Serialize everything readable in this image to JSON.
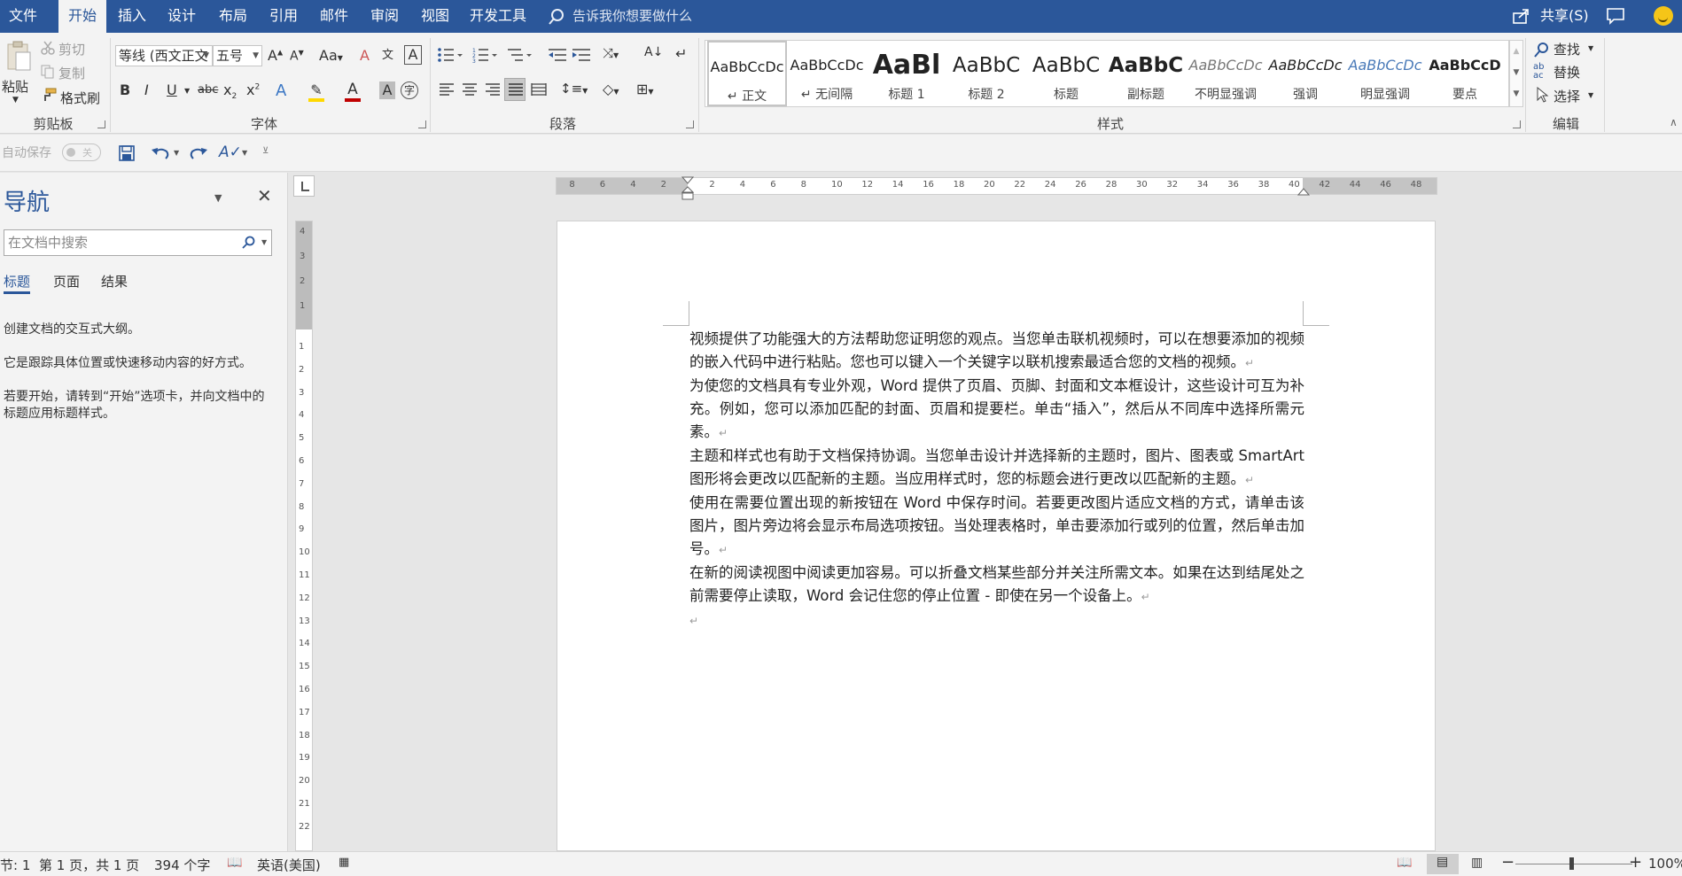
{
  "menubar": {
    "tabs": [
      "文件",
      "开始",
      "插入",
      "设计",
      "布局",
      "引用",
      "邮件",
      "审阅",
      "视图",
      "开发工具"
    ],
    "active_tab": "开始",
    "tell_me": "告诉我你想要做什么",
    "share": "共享(S)"
  },
  "ribbon": {
    "clipboard": {
      "paste": "粘贴",
      "cut": "剪切",
      "copy": "复制",
      "format_painter": "格式刷",
      "label": "剪贴板"
    },
    "font": {
      "font_name": "等线 (西文正文",
      "font_size": "五号",
      "change_case": "Aa",
      "label": "字体"
    },
    "paragraph": {
      "label": "段落"
    },
    "styles": {
      "label": "样式",
      "items": [
        {
          "sample": "AaBbCcDc",
          "name": "正文"
        },
        {
          "sample": "AaBbCcDc",
          "name": "无间隔"
        },
        {
          "sample": "AaBl",
          "name": "标题 1"
        },
        {
          "sample": "AaBbC",
          "name": "标题 2"
        },
        {
          "sample": "AaBbC",
          "name": "标题"
        },
        {
          "sample": "AaBbC",
          "name": "副标题"
        },
        {
          "sample": "AaBbCcDc",
          "name": "不明显强调"
        },
        {
          "sample": "AaBbCcDc",
          "name": "强调"
        },
        {
          "sample": "AaBbCcDc",
          "name": "明显强调"
        },
        {
          "sample": "AaBbCcD",
          "name": "要点"
        }
      ]
    },
    "editing": {
      "find": "查找",
      "replace": "替换",
      "select": "选择",
      "label": "编辑"
    }
  },
  "qat": {
    "autosave": "自动保存",
    "autosave_state": "关"
  },
  "nav": {
    "title": "导航",
    "search_placeholder": "在文档中搜索",
    "tabs": [
      "标题",
      "页面",
      "结果"
    ],
    "text1": "创建文档的交互式大纲。",
    "text2": "它是跟踪具体位置或快速移动内容的好方式。",
    "text3": "若要开始，请转到“开始”选项卡，并向文档中的标题应用标题样式。"
  },
  "ruler": {
    "h_left": [
      "8",
      "6",
      "4",
      "2"
    ],
    "h_right": [
      "2",
      "4",
      "6",
      "8",
      "10",
      "12",
      "14",
      "16",
      "18",
      "20",
      "22",
      "24",
      "26",
      "28",
      "30",
      "32",
      "34",
      "36",
      "38",
      "40",
      "42",
      "44",
      "46",
      "48"
    ],
    "v_top": [
      "4",
      "3",
      "2",
      "1"
    ],
    "v_nums": [
      "1",
      "2",
      "3",
      "4",
      "5",
      "6",
      "7",
      "8",
      "9",
      "10",
      "11",
      "12",
      "13",
      "14",
      "15",
      "16",
      "17",
      "18",
      "19",
      "20",
      "21",
      "22"
    ]
  },
  "document": {
    "paragraphs": [
      "视频提供了功能强大的方法帮助您证明您的观点。当您单击联机视频时，可以在想要添加的视频的嵌入代码中进行粘贴。您也可以键入一个关键字以联机搜索最适合您的文档的视频。",
      "为使您的文档具有专业外观，Word 提供了页眉、页脚、封面和文本框设计，这些设计可互为补充。例如，您可以添加匹配的封面、页眉和提要栏。单击“插入”，然后从不同库中选择所需元素。",
      "主题和样式也有助于文档保持协调。当您单击设计并选择新的主题时，图片、图表或 SmartArt 图形将会更改以匹配新的主题。当应用样式时，您的标题会进行更改以匹配新的主题。",
      "使用在需要位置出现的新按钮在 Word 中保存时间。若要更改图片适应文档的方式，请单击该图片，图片旁边将会显示布局选项按钮。当处理表格时，单击要添加行或列的位置，然后单击加号。",
      "在新的阅读视图中阅读更加容易。可以折叠文档某些部分并关注所需文本。如果在达到结尾处之前需要停止读取，Word 会记住您的停止位置 - 即使在另一个设备上。",
      ""
    ]
  },
  "status": {
    "section": "节: 1",
    "page": "第 1 页，共 1 页",
    "words": "394 个字",
    "language": "英语(美国)",
    "zoom": "100%"
  },
  "colors": {
    "accent": "#2b579a",
    "ribbon_bg": "#f3f3f3"
  }
}
